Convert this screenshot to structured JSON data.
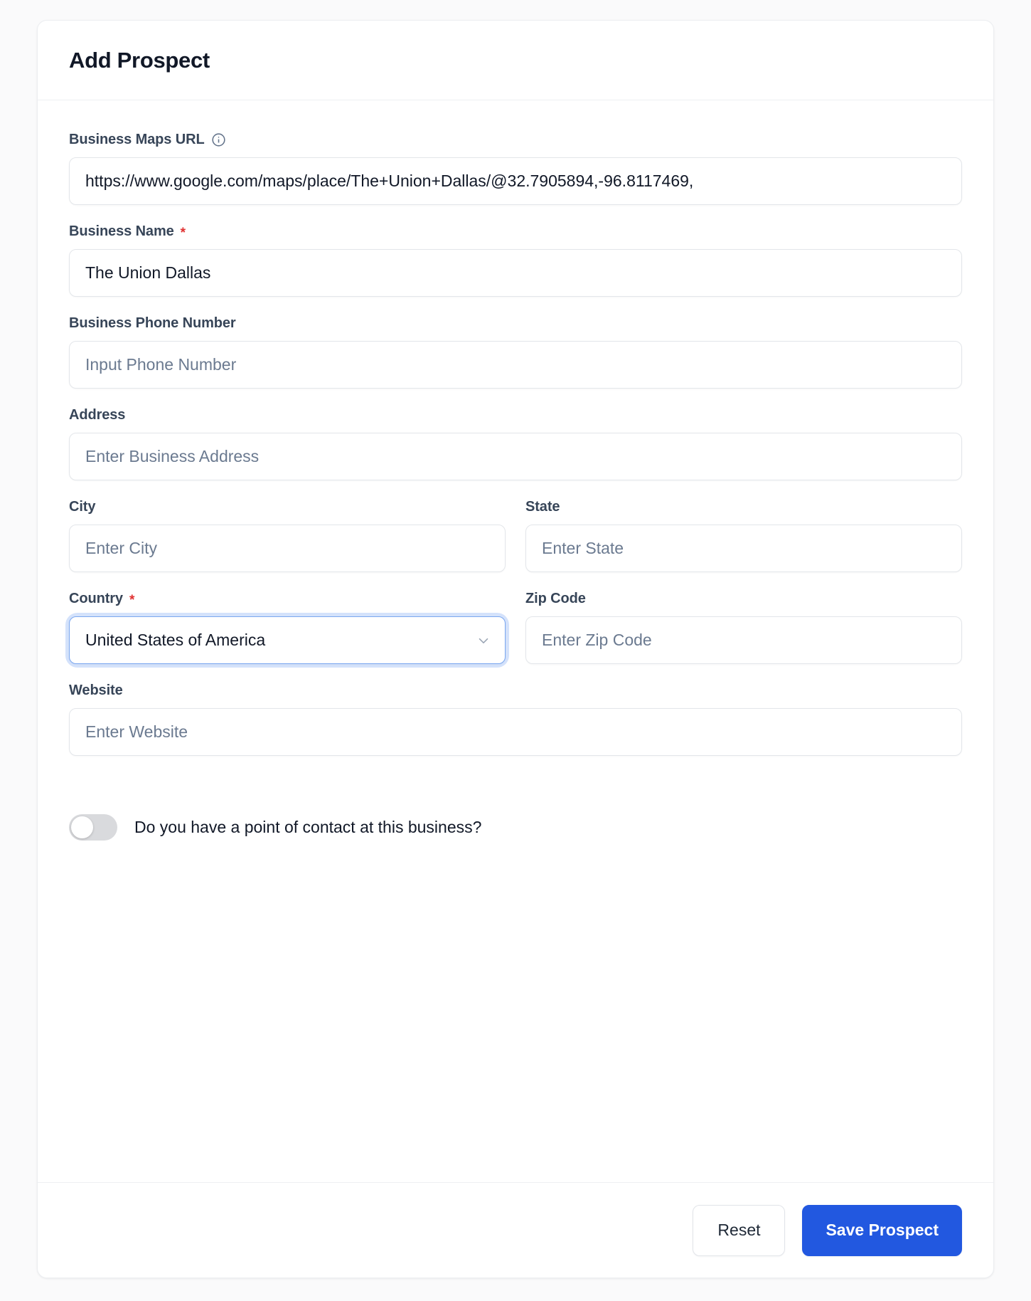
{
  "card": {
    "title": "Add Prospect"
  },
  "fields": {
    "maps_url": {
      "label": "Business Maps URL",
      "info_icon": "info-icon",
      "value": "https://www.google.com/maps/place/The+Union+Dallas/@32.7905894,-96.8117469,",
      "placeholder": ""
    },
    "business_name": {
      "label": "Business Name",
      "required_marker": "*",
      "value": "The Union Dallas",
      "placeholder": ""
    },
    "phone": {
      "label": "Business Phone Number",
      "value": "",
      "placeholder": "Input Phone Number"
    },
    "address": {
      "label": "Address",
      "value": "",
      "placeholder": "Enter Business Address"
    },
    "city": {
      "label": "City",
      "value": "",
      "placeholder": "Enter City"
    },
    "state": {
      "label": "State",
      "value": "",
      "placeholder": "Enter State"
    },
    "country": {
      "label": "Country",
      "required_marker": "*",
      "value": "United States of America",
      "chevron_icon": "chevron-down-icon"
    },
    "zip": {
      "label": "Zip Code",
      "value": "",
      "placeholder": "Enter Zip Code"
    },
    "website": {
      "label": "Website",
      "value": "",
      "placeholder": "Enter Website"
    }
  },
  "toggle": {
    "label": "Do you have a point of contact at this business?",
    "state": "off"
  },
  "footer": {
    "reset_label": "Reset",
    "save_label": "Save Prospect"
  },
  "colors": {
    "primary": "#2258e0",
    "required": "#e03131",
    "focus_ring": "#d4e2fb",
    "label": "#374558",
    "placeholder": "#6b7a90"
  }
}
